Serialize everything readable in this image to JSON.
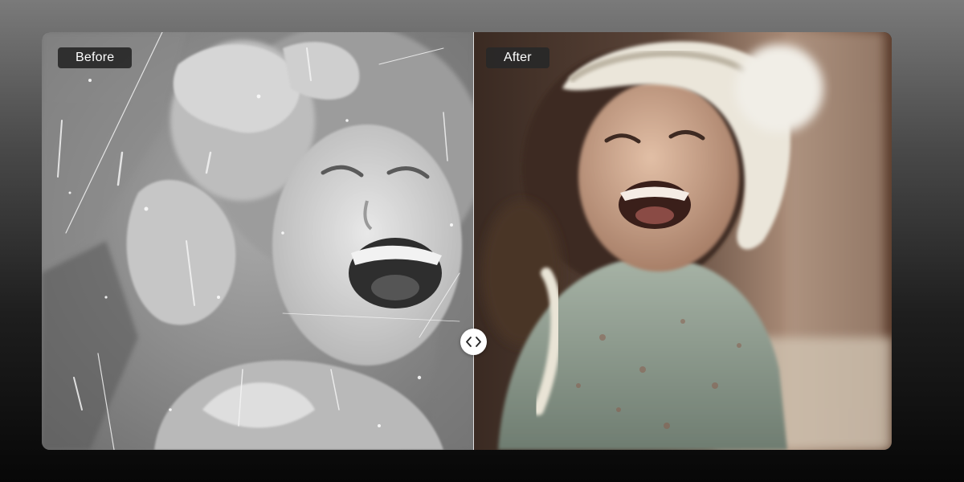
{
  "comparison": {
    "before_label": "Before",
    "after_label": "After",
    "handle_icon": "chevron-left-right-icon",
    "split_position_percent": 50.8
  },
  "colors": {
    "label_bg": "#282828",
    "label_text": "#ffffff",
    "divider": "#ffffff",
    "handle_bg": "#ffffff"
  }
}
